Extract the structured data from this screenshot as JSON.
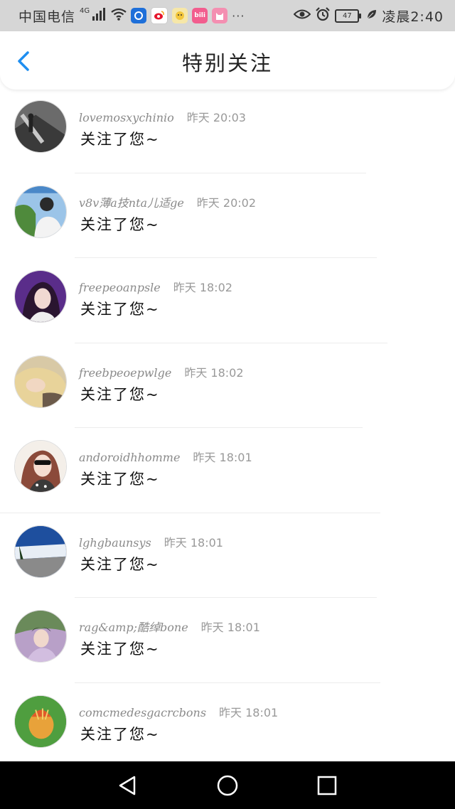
{
  "status_bar": {
    "carrier": "中国电信",
    "network": "4G",
    "battery": "47",
    "time": "凌晨2:40",
    "more": "···"
  },
  "header": {
    "title": "特别关注",
    "back_icon": "chevron-left-icon"
  },
  "colors": {
    "accent": "#1e8ef0",
    "status_bar_bg": "#d6d6d6",
    "nav_bar_bg": "#000000"
  },
  "notifications": [
    {
      "username": "lovemosxychinio",
      "time": "昨天 20:03",
      "message": "关注了您~"
    },
    {
      "username": "v8v薄a技nta儿适ge",
      "time": "昨天 20:02",
      "message": "关注了您~"
    },
    {
      "username": "freepeoanpsle",
      "time": "昨天 18:02",
      "message": "关注了您~"
    },
    {
      "username": "freebpeoepwlge",
      "time": "昨天 18:02",
      "message": "关注了您~"
    },
    {
      "username": "andoroidhhomme",
      "time": "昨天 18:01",
      "message": "关注了您~"
    },
    {
      "username": "lghgbaunsys",
      "time": "昨天 18:01",
      "message": "关注了您~"
    },
    {
      "username": "rag&amp;酷绰bone",
      "time": "昨天 18:01",
      "message": "关注了您~"
    },
    {
      "username": "comcmedesgacrcbons",
      "time": "昨天 18:01",
      "message": "关注了您~"
    }
  ],
  "nav_bar": {
    "back_icon": "triangle-back-icon",
    "home_icon": "circle-home-icon",
    "recents_icon": "square-recents-icon"
  }
}
